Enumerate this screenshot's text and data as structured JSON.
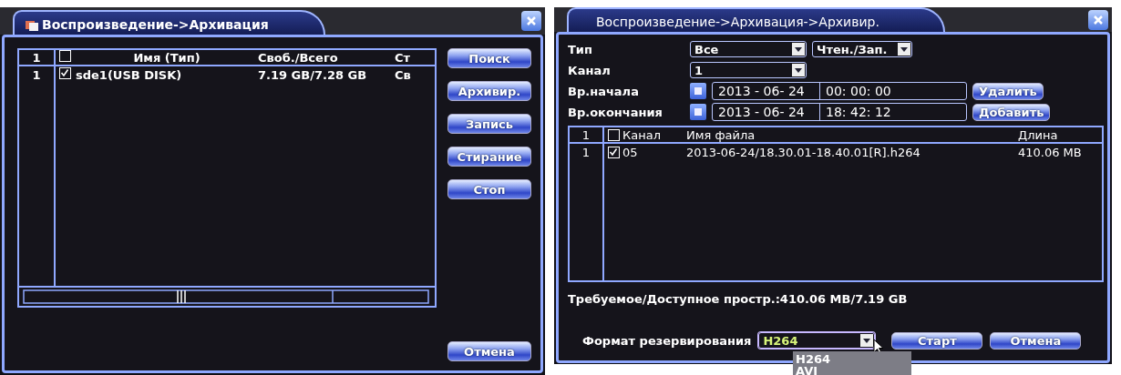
{
  "left": {
    "title": "Воспроизведение->Архивация",
    "table": {
      "columns": [
        "1",
        "Имя (Тип)",
        "Своб./Всего",
        "Ст"
      ],
      "header_checked": false,
      "rows": [
        {
          "index": "1",
          "checked": true,
          "name": "sde1(USB DISK)",
          "free_total": "7.19 GB/7.28 GB",
          "column_4": "Св"
        }
      ]
    },
    "buttons": [
      "Поиск",
      "Архивир.",
      "Запись",
      "Стирание",
      "Стоп"
    ],
    "cancel_button": "Отмена"
  },
  "right": {
    "title": "Воспроизведение->Архивация->Архивир.",
    "fields": [
      {
        "kind": "selects",
        "label": "Тип",
        "values": [
          "Все",
          "Чтен./Зап."
        ]
      },
      {
        "kind": "selects",
        "label": "Канал",
        "values": [
          "1"
        ]
      },
      {
        "kind": "datetime",
        "label": "Вр.начала",
        "date": "2013 - 06- 24",
        "time": "00: 00: 00",
        "button": "Удалить"
      },
      {
        "kind": "datetime",
        "label": "Вр.окончания",
        "date": "2013 - 06- 24",
        "time": "18: 42: 12",
        "button": "Добавить"
      }
    ],
    "table": {
      "columns": [
        "1",
        "Канал",
        "Имя файла",
        "Длина"
      ],
      "header_checked": false,
      "rows": [
        {
          "index": "1",
          "checked": true,
          "channel": "05",
          "file": "2013-06-24/18.30.01-18.40.01[R].h264",
          "length": "410.06 MB"
        }
      ]
    },
    "space": "Требуемое/Доступное простр.:410.06 MB/7.19 GB",
    "format": {
      "label": "Формат резервирования",
      "value": "H264",
      "expanded": true,
      "options": [
        "H264",
        "AVI"
      ]
    },
    "buttons": [
      "Старт",
      "Отмена"
    ]
  }
}
